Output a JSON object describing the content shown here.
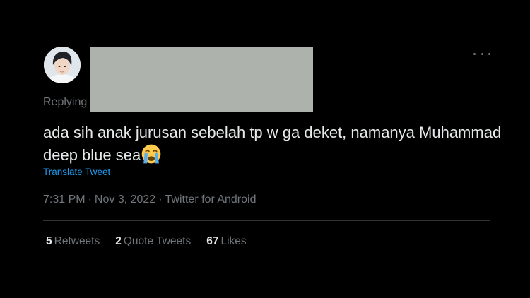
{
  "tweet": {
    "replying_label": "Replying",
    "text": "ada sih anak jurusan sebelah tp w ga deket, namanya Muhammad deep blue sea",
    "emoji": "loudly-crying-face-emoji",
    "translate_label": "Translate Tweet",
    "time": "7:31 PM",
    "date": "Nov 3, 2022",
    "source": "Twitter for Android",
    "separator": "·"
  },
  "stats": {
    "retweets_count": "5",
    "retweets_label": "Retweets",
    "quotes_count": "2",
    "quotes_label": "Quote Tweets",
    "likes_count": "67",
    "likes_label": "Likes"
  },
  "icons": {
    "more": "more-options-icon"
  },
  "colors": {
    "background": "#000000",
    "text_primary": "#e7e9ea",
    "text_secondary": "#71767b",
    "link": "#1d9bf0",
    "divider": "#2f3336",
    "redaction": "#aeb2ad"
  }
}
